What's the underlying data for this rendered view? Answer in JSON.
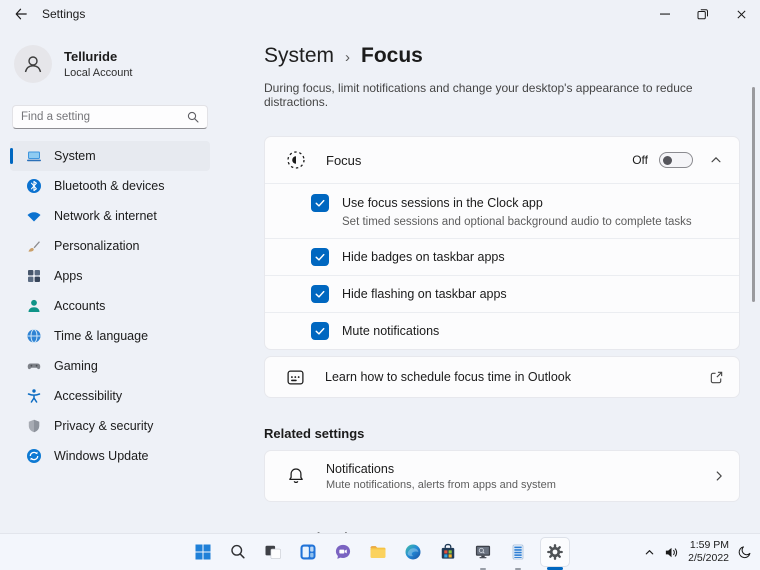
{
  "window": {
    "title": "Settings"
  },
  "sidebar": {
    "user": {
      "name": "Telluride",
      "type": "Local Account"
    },
    "search": {
      "placeholder": "Find a setting"
    },
    "items": [
      {
        "label": "System",
        "selected": true
      },
      {
        "label": "Bluetooth & devices"
      },
      {
        "label": "Network & internet"
      },
      {
        "label": "Personalization"
      },
      {
        "label": "Apps"
      },
      {
        "label": "Accounts"
      },
      {
        "label": "Time & language"
      },
      {
        "label": "Gaming"
      },
      {
        "label": "Accessibility"
      },
      {
        "label": "Privacy & security"
      },
      {
        "label": "Windows Update"
      }
    ]
  },
  "main": {
    "breadcrumb": {
      "parent": "System",
      "separator": "›",
      "current": "Focus"
    },
    "description": "During focus, limit notifications and change your desktop's appearance to reduce distractions.",
    "focus_card": {
      "label": "Focus",
      "toggle_state": "Off",
      "options": [
        {
          "label": "Use focus sessions in the Clock app",
          "description": "Set timed sessions and optional background audio to complete tasks",
          "checked": true
        },
        {
          "label": "Hide badges on taskbar apps",
          "checked": true
        },
        {
          "label": "Hide flashing on taskbar apps",
          "checked": true
        },
        {
          "label": "Mute notifications",
          "checked": true
        }
      ]
    },
    "outlook_link": {
      "label": "Learn how to schedule focus time in Outlook"
    },
    "related_settings": {
      "header": "Related settings",
      "notifications": {
        "title": "Notifications",
        "description": "Mute notifications, alerts from apps and system"
      }
    },
    "automatic_rules_header": "Automatic rules"
  },
  "taskbar": {
    "apps": [
      "start",
      "search",
      "task-view",
      "widgets",
      "chat",
      "file-explorer",
      "edge",
      "store",
      "monitor-app",
      "notes-app",
      "settings"
    ],
    "active_app": "settings",
    "tray": {
      "time": "1:59 PM",
      "date": "2/5/2022"
    }
  },
  "colors": {
    "accent": "#0067c0",
    "background": "#eef1f7",
    "card": "#fcfcfd"
  }
}
